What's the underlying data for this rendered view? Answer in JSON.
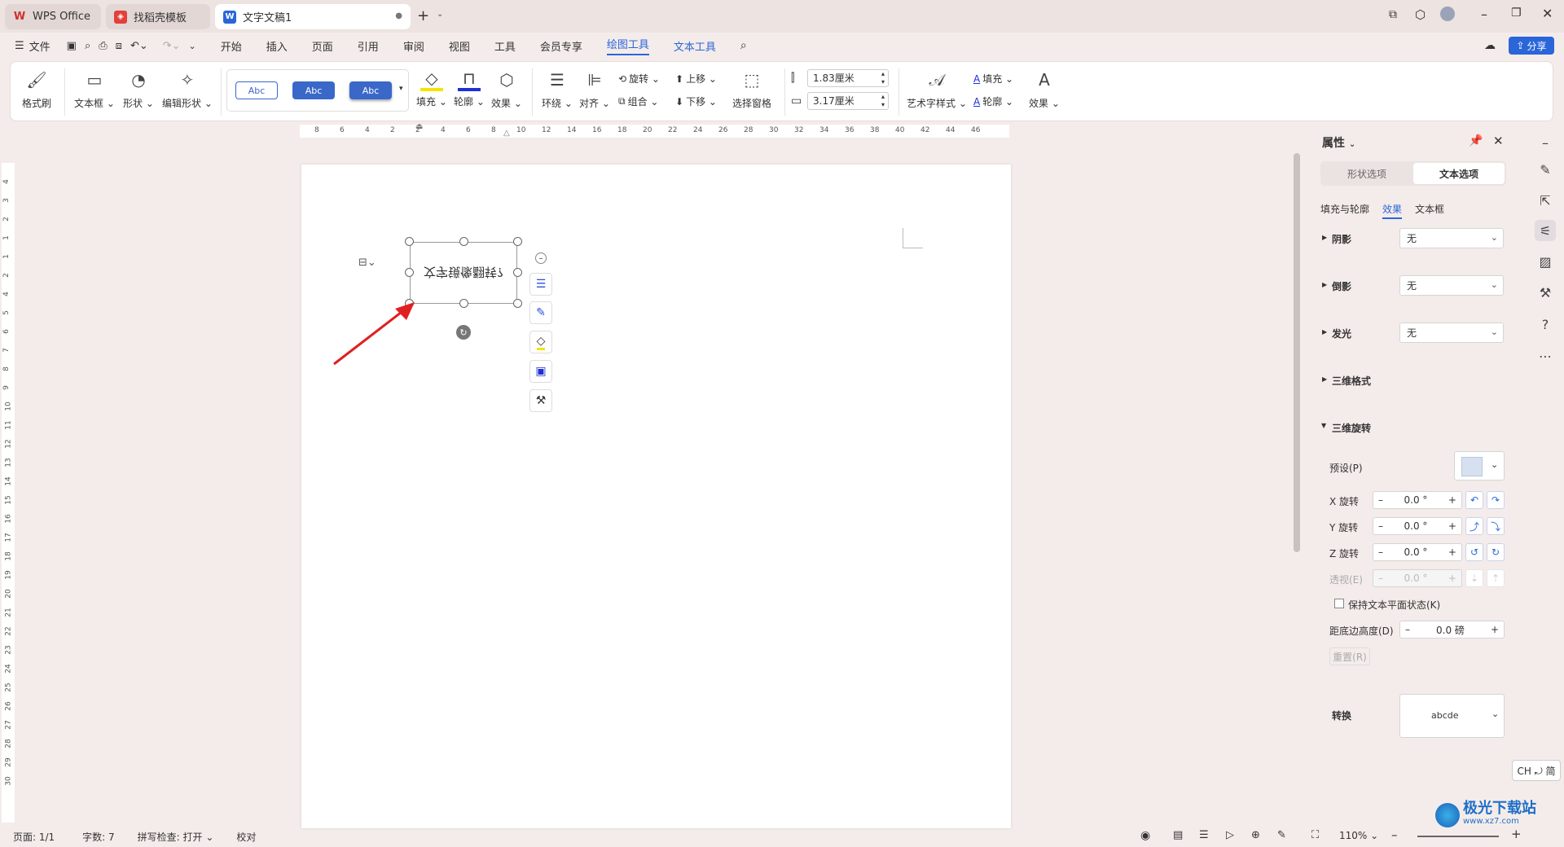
{
  "tabs": [
    {
      "label": "WPS Office"
    },
    {
      "label": "找稻壳模板"
    },
    {
      "label": "文字文稿1"
    }
  ],
  "menubar": {
    "file": "文件",
    "items": [
      "开始",
      "插入",
      "页面",
      "引用",
      "审阅",
      "视图",
      "工具",
      "会员专享",
      "绘图工具",
      "文本工具"
    ],
    "share": "分享"
  },
  "ribbon": {
    "format_painter": "格式刷",
    "textbox": "文本框",
    "shape": "形状",
    "edit_shape": "编辑形状",
    "style_samples": [
      "Abc",
      "Abc",
      "Abc"
    ],
    "fill": "填充",
    "outline": "轮廓",
    "effect": "效果",
    "wrap": "环绕",
    "align": "对齐",
    "rotate": "旋转",
    "group": "组合",
    "bring_up": "上移",
    "send_down": "下移",
    "selection_pane": "选择窗格",
    "height": "1.83厘米",
    "width": "3.17厘米",
    "art_style": "艺术字样式",
    "text_fill": "填充",
    "text_outline": "轮廓",
    "text_effect": "效果"
  },
  "ruler": {
    "h_ticks": [
      "8",
      "6",
      "4",
      "2",
      "2",
      "4",
      "6",
      "8",
      "10",
      "12",
      "14",
      "16",
      "18",
      "20",
      "22",
      "24",
      "26",
      "28",
      "30",
      "32",
      "34",
      "36",
      "38",
      "40",
      "42",
      "44",
      "46"
    ],
    "v_ticks": [
      "4",
      "3",
      "2",
      "1",
      "1",
      "2",
      "4",
      "5",
      "6",
      "7",
      "8",
      "9",
      "10",
      "11",
      "12",
      "13",
      "14",
      "15",
      "16",
      "17",
      "18",
      "19",
      "20",
      "21",
      "22",
      "23",
      "24",
      "25",
      "26",
      "27",
      "28",
      "29",
      "30"
    ]
  },
  "document": {
    "textbox_text": "文字镜像翻转?"
  },
  "panel": {
    "title": "属性",
    "tab_shape": "形状选项",
    "tab_text": "文本选项",
    "subtab_fill": "填充与轮廓",
    "subtab_effect": "效果",
    "subtab_textbox": "文本框",
    "shadow": "阴影",
    "reflection": "倒影",
    "glow": "发光",
    "none": "无",
    "format3d": "三维格式",
    "rotation3d": "三维旋转",
    "preset": "预设(P)",
    "x_rot": "X 旋转",
    "y_rot": "Y 旋转",
    "z_rot": "Z 旋转",
    "perspective": "透视(E)",
    "rot_value": "0.0",
    "deg": "°",
    "keep_flat": "保持文本平面状态(K)",
    "distance": "距底边高度(D)",
    "distance_value": "0.0",
    "distance_unit": "磅",
    "reset": "重置(R)",
    "transform": "转换",
    "transform_sample": "abcde"
  },
  "ime": "CH ⤾ 简",
  "status": {
    "page": "页面: 1/1",
    "words": "字数: 7",
    "spell": "拼写检查: 打开",
    "proof": "校对",
    "zoom": "110%"
  },
  "watermark": {
    "text": "极光下载站",
    "url": "www.xz7.com"
  },
  "colors": {
    "accent": "#2b66d9",
    "wps_red": "#d0302d",
    "arrow": "#e02020"
  }
}
